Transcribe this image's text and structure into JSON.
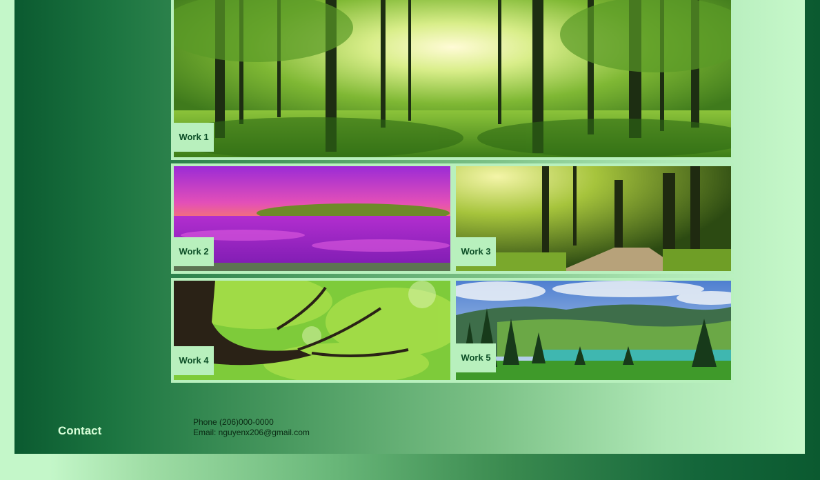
{
  "gallery": {
    "items": [
      {
        "label": "Work 1",
        "scene": "sunlit-forest-photo"
      },
      {
        "label": "Work 2",
        "scene": "lavender-field-sunset-photo"
      },
      {
        "label": "Work 3",
        "scene": "forest-road-photo"
      },
      {
        "label": "Work 4",
        "scene": "tree-canopy-photo"
      },
      {
        "label": "Work 5",
        "scene": "mountain-lake-photo"
      }
    ]
  },
  "contact": {
    "heading": "Contact",
    "phone": "Phone (206)000-0000",
    "email": "Email: nguyenx206@gmail.com"
  },
  "colors": {
    "frame": "#b8f0bd",
    "caption_text": "#0d4f27",
    "dark_green": "#0b5a30",
    "light_green": "#c4f7c9"
  }
}
